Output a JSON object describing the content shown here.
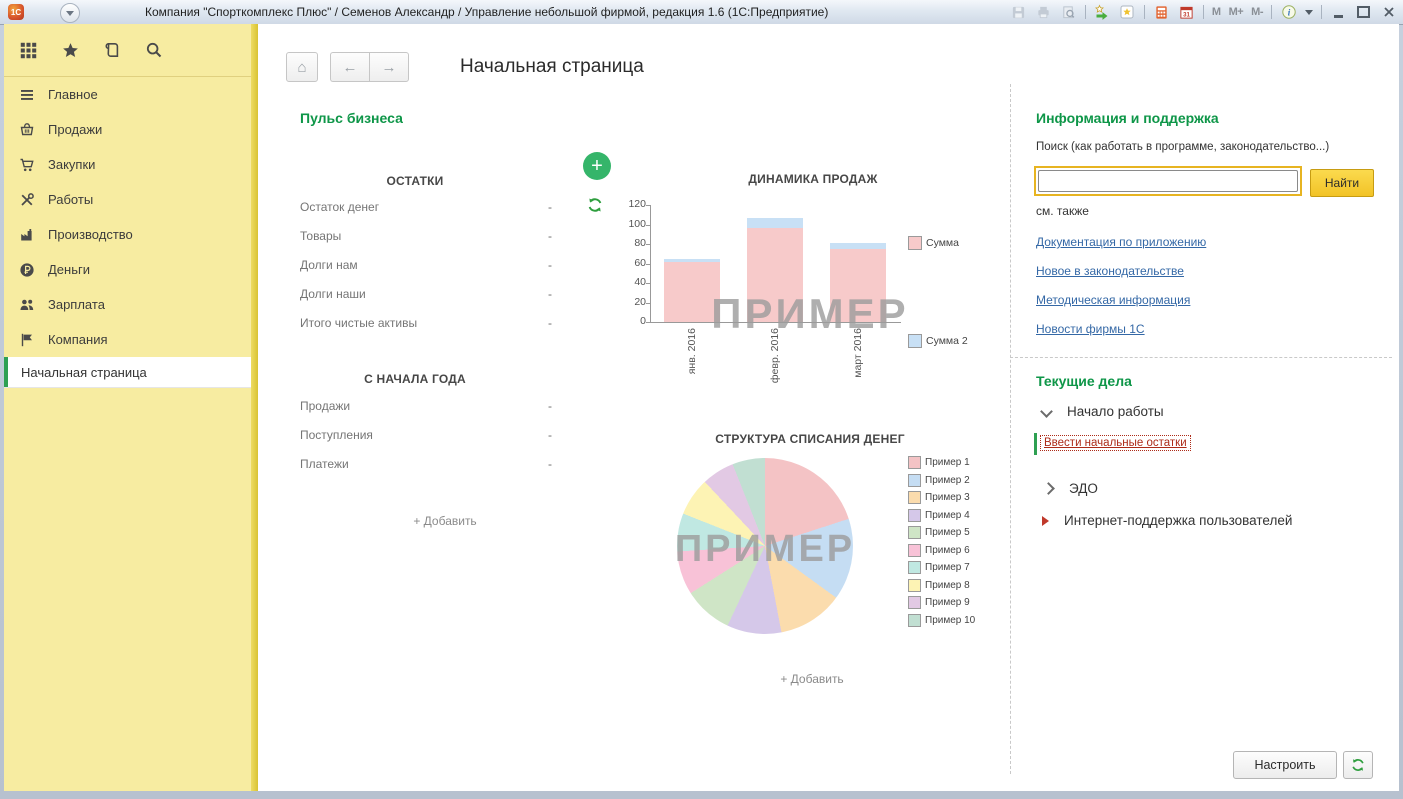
{
  "titlebar": {
    "title": "Компания \"Спорткомплекс Плюс\" / Семенов Александр / Управление небольшой фирмой, редакция 1.6  (1С:Предприятие)",
    "memory_buttons": [
      "M",
      "M+",
      "M-"
    ],
    "icons": [
      "save-icon",
      "print-icon",
      "print-preview-icon",
      "add-favorite-icon",
      "favorites-icon",
      "calculator-icon",
      "calendar-icon",
      "info-icon",
      "minimize-icon",
      "maximize-icon",
      "close-icon"
    ]
  },
  "sidebar": {
    "top_icons": [
      "apps-grid-icon",
      "star-icon",
      "history-icon",
      "search-icon"
    ],
    "items": [
      {
        "icon": "menu-icon",
        "label": "Главное"
      },
      {
        "icon": "basket-icon",
        "label": "Продажи"
      },
      {
        "icon": "cart-icon",
        "label": "Закупки"
      },
      {
        "icon": "tools-icon",
        "label": "Работы"
      },
      {
        "icon": "factory-icon",
        "label": "Производство"
      },
      {
        "icon": "ruble-icon",
        "label": "Деньги"
      },
      {
        "icon": "people-icon",
        "label": "Зарплата"
      },
      {
        "icon": "flag-icon",
        "label": "Компания"
      }
    ],
    "active_item": "Начальная страница"
  },
  "header": {
    "title": "Начальная страница"
  },
  "pulse": {
    "title": "Пульс бизнеса",
    "balances": {
      "title": "ОСТАТКИ",
      "rows": [
        {
          "label": "Остаток денег",
          "value": "-"
        },
        {
          "label": "Товары",
          "value": "-"
        },
        {
          "label": "Долги нам",
          "value": "-"
        },
        {
          "label": "Долги наши",
          "value": "-"
        },
        {
          "label": "Итого чистые активы",
          "value": "-"
        }
      ]
    },
    "ytd": {
      "title": "С НАЧАЛА ГОДА",
      "rows": [
        {
          "label": "Продажи",
          "value": "-"
        },
        {
          "label": "Поступления",
          "value": "-"
        },
        {
          "label": "Платежи",
          "value": "-"
        }
      ]
    },
    "add_label_left": "+ Добавить",
    "add_label_pie": "+ Добавить"
  },
  "chart_data": [
    {
      "type": "bar",
      "stacked": true,
      "title": "ДИНАМИКА ПРОДАЖ",
      "categories": [
        "янв. 2016",
        "февр. 2016",
        "март 2016"
      ],
      "series": [
        {
          "name": "Сумма",
          "color": "#f7caca",
          "values": [
            62,
            96,
            75
          ]
        },
        {
          "name": "Сумма 2",
          "color": "#c8e0f5",
          "values": [
            3,
            11,
            6
          ]
        }
      ],
      "ylim": [
        0,
        120
      ],
      "yticks": [
        0,
        20,
        40,
        60,
        80,
        100,
        120
      ],
      "legend_position": "right",
      "watermark": "ПРИМЕР"
    },
    {
      "type": "pie",
      "title": "СТРУКТУРА СПИСАНИЯ ДЕНЕГ",
      "labels": [
        "Пример 1",
        "Пример 2",
        "Пример 3",
        "Пример 4",
        "Пример 5",
        "Пример 6",
        "Пример 7",
        "Пример 8",
        "Пример 9",
        "Пример 10"
      ],
      "values": [
        20,
        15,
        12,
        10,
        9,
        8,
        7,
        7,
        6,
        6
      ],
      "colors": [
        "#f4c3c5",
        "#c5ddf3",
        "#fbdcad",
        "#d5c8e9",
        "#cfe5c6",
        "#f8c2d7",
        "#c0e8e2",
        "#fdf3b4",
        "#e2c9e4",
        "#c1dfd2"
      ],
      "legend_position": "right",
      "watermark": "ПРИМЕР"
    }
  ],
  "support": {
    "title": "Информация и поддержка",
    "search_label": "Поиск (как работать в программе, законодательство...)",
    "search_value": "",
    "find_button": "Найти",
    "see_also": "см. также",
    "links": [
      "Документация по приложению",
      "Новое в законодательстве",
      "Методическая информация",
      "Новости фирмы 1С"
    ]
  },
  "todo": {
    "title": "Текущие дела",
    "groups": [
      {
        "label": "Начало работы",
        "state": "expanded",
        "links": [
          "Ввести начальные остатки"
        ]
      },
      {
        "label": "ЭДО",
        "state": "collapsed"
      },
      {
        "label": "Интернет-поддержка пользователей",
        "state": "action"
      }
    ]
  },
  "footer": {
    "configure_button": "Настроить"
  },
  "colors": {
    "accent_green": "#0e9648",
    "sidebar_yellow": "#f7eca1",
    "sidebar_strip_gold": "#d9c332",
    "link_blue": "#3468a6",
    "alert_red": "#ad2b18",
    "find_button_yellow": "#f2c327",
    "plus_button_green": "#35b56a",
    "watermark_gray": "#9c9c9c"
  }
}
